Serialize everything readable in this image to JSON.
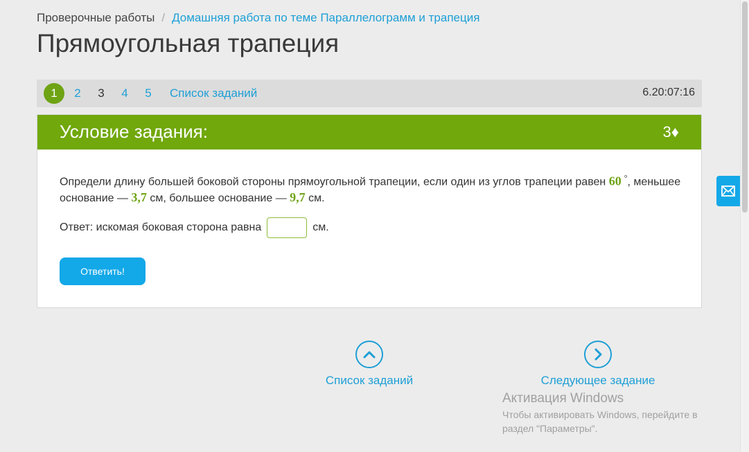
{
  "breadcrumb": {
    "root": "Проверочные работы",
    "separator": "/",
    "current": "Домашняя работа по теме Параллелограмм и трапеция"
  },
  "page_title": "Прямоугольная трапеция",
  "nav": {
    "items": [
      {
        "label": "1",
        "state": "active"
      },
      {
        "label": "2",
        "state": "link"
      },
      {
        "label": "3",
        "state": "plain"
      },
      {
        "label": "4",
        "state": "link"
      },
      {
        "label": "5",
        "state": "link"
      }
    ],
    "list_link": "Список заданий",
    "timer": "6.20:07:16"
  },
  "task": {
    "header_title": "Условие задания:",
    "points": "3♦",
    "text_part1": "Определи длину большей боковой стороны прямоугольной трапеции, если один из углов трапеции равен ",
    "angle": "60",
    "degree_symbol": "°",
    "text_part2": ", меньшее основание — ",
    "small_base": "3,7",
    "text_part3": " см, большее основание — ",
    "large_base": "9,7",
    "text_part4": " см.",
    "answer_prefix": "Ответ: искомая боковая сторона равна",
    "answer_value": "",
    "answer_suffix": "см.",
    "submit_label": "Ответить!"
  },
  "bottom_nav": {
    "list_label": "Список заданий",
    "next_label": "Следующее задание"
  },
  "activation": {
    "title": "Активация Windows",
    "line1": "Чтобы активировать Windows, перейдите в",
    "line2": "раздел \"Параметры\"."
  },
  "colors": {
    "accent_green": "#71a80c",
    "link_blue": "#1e9fd6",
    "button_blue": "#13a8e8"
  },
  "icons": {
    "list_nav": "chevron-up-icon",
    "next_nav": "chevron-right-icon",
    "feedback": "mail-icon"
  }
}
